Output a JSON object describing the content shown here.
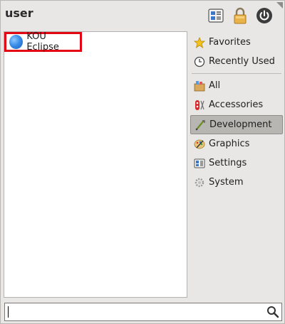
{
  "header": {
    "username": "user"
  },
  "icons": {
    "switch_user": "switch-user-icon",
    "lock": "lock-icon",
    "power": "power-icon",
    "search": "magnifier-icon"
  },
  "apps": [
    {
      "label": "KOU Eclipse",
      "icon": "globe-icon",
      "highlighted": true
    }
  ],
  "categories": [
    {
      "label": "Favorites",
      "icon": "star-icon"
    },
    {
      "label": "Recently Used",
      "icon": "clock-icon"
    },
    {
      "label": "All",
      "icon": "all-apps-icon"
    },
    {
      "label": "Accessories",
      "icon": "accessories-icon"
    },
    {
      "label": "Development",
      "icon": "development-icon",
      "selected": true
    },
    {
      "label": "Graphics",
      "icon": "graphics-icon"
    },
    {
      "label": "Settings",
      "icon": "settings-icon"
    },
    {
      "label": "System",
      "icon": "system-icon"
    }
  ],
  "search": {
    "value": "",
    "placeholder": ""
  },
  "colors": {
    "highlight_border": "#e30613",
    "selected_bg": "#b8b6b3",
    "window_bg": "#e8e7e6"
  }
}
